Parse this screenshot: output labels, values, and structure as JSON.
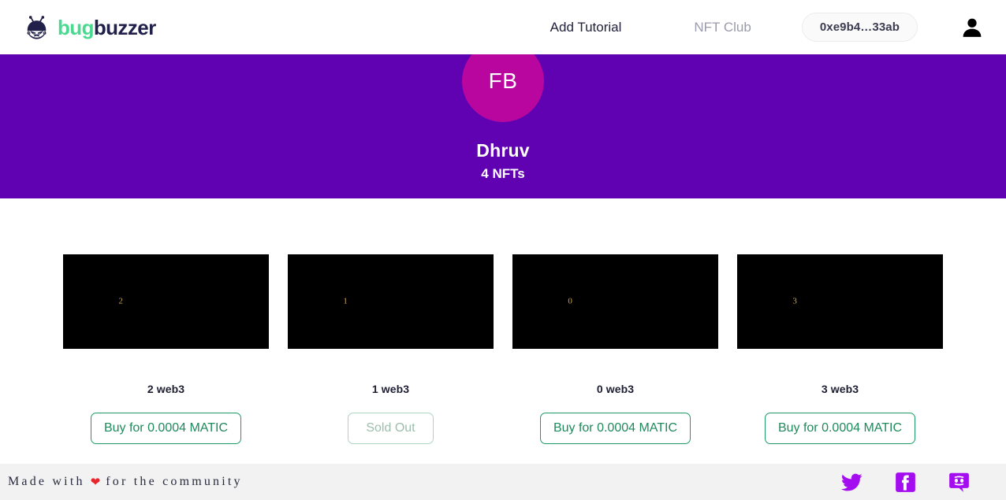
{
  "header": {
    "brand": {
      "icon": "bug-logo-icon",
      "text_first": "bug",
      "text_second": "buzzer"
    },
    "nav_links": [
      {
        "label": "Add Tutorial",
        "muted": false
      },
      {
        "label": "NFT Club",
        "muted": true
      }
    ],
    "wallet_address": "0xe9b4…33ab",
    "profile_icon": "person-icon"
  },
  "banner": {
    "avatar_initials": "FB",
    "avatar_color": "#b8069e",
    "banner_color": "#6002b2",
    "profile_name": "Dhruv",
    "nft_count_label": "4 NFTs"
  },
  "cards": [
    {
      "media_number": "2",
      "title": "2 web3",
      "button_label": "Buy for 0.0004 MATIC",
      "sold_out": false
    },
    {
      "media_number": "1",
      "title": "1 web3",
      "button_label": "Sold Out",
      "sold_out": true
    },
    {
      "media_number": "0",
      "title": "0 web3",
      "button_label": "Buy for 0.0004 MATIC",
      "sold_out": false
    },
    {
      "media_number": "3",
      "title": "3 web3",
      "button_label": "Buy for 0.0004 MATIC",
      "sold_out": false
    }
  ],
  "footer": {
    "text_before": "Made with",
    "heart": "❤",
    "text_after": "for the community",
    "socials": [
      {
        "name": "twitter-icon"
      },
      {
        "name": "facebook-icon"
      },
      {
        "name": "discord-icon"
      }
    ],
    "social_color": "#a40df0"
  }
}
